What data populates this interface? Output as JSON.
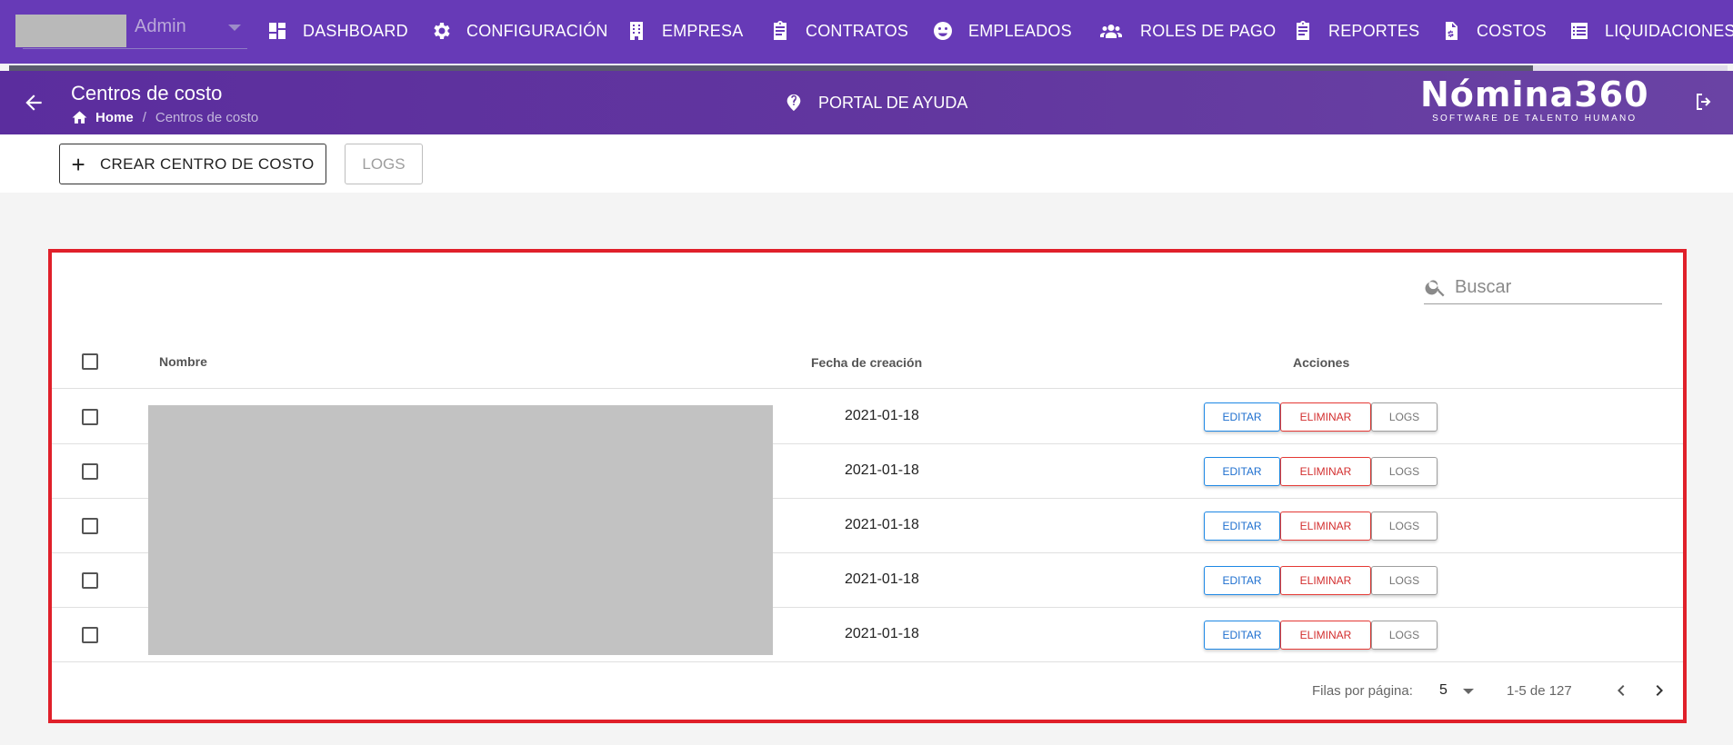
{
  "user": {
    "name": "Admin"
  },
  "nav": [
    {
      "label": "DASHBOARD",
      "icon": "dashboard-icon"
    },
    {
      "label": "CONFIGURACIÓN",
      "icon": "gear-icon"
    },
    {
      "label": "EMPRESA",
      "icon": "building-icon"
    },
    {
      "label": "CONTRATOS",
      "icon": "clipboard-icon"
    },
    {
      "label": "EMPLEADOS",
      "icon": "face-icon"
    },
    {
      "label": "ROLES DE PAGO",
      "icon": "people-icon"
    },
    {
      "label": "REPORTES",
      "icon": "clipboard-icon"
    },
    {
      "label": "COSTOS",
      "icon": "dollar-file-icon"
    },
    {
      "label": "LIQUIDACIONES",
      "icon": "list-icon"
    }
  ],
  "header": {
    "title": "Centros de costo",
    "breadcrumb_home": "Home",
    "breadcrumb_sep": "/",
    "breadcrumb_current": "Centros de costo",
    "help_label": "PORTAL DE AYUDA",
    "logo_main": "Nómina360",
    "logo_sub": "SOFTWARE DE TALENTO HUMANO"
  },
  "toolbar": {
    "create_label": "CREAR CENTRO DE COSTO",
    "create_plus": "+",
    "logs_label": "LOGS"
  },
  "search": {
    "placeholder": "Buscar"
  },
  "table": {
    "headers": {
      "name": "Nombre",
      "date": "Fecha de creación",
      "actions": "Acciones"
    },
    "actions": {
      "edit": "EDITAR",
      "delete": "ELIMINAR",
      "logs": "LOGS"
    },
    "rows": [
      {
        "date": "2021-01-18"
      },
      {
        "date": "2021-01-18"
      },
      {
        "date": "2021-01-18"
      },
      {
        "date": "2021-01-18"
      },
      {
        "date": "2021-01-18"
      }
    ]
  },
  "pagination": {
    "rows_per_page_label": "Filas por página:",
    "rows_per_page": "5",
    "range": "1-5 de 127"
  },
  "colors": {
    "primary": "#673ab7",
    "highlight_border": "#e0202a",
    "edit": "#1e88e5",
    "delete": "#e53935"
  }
}
